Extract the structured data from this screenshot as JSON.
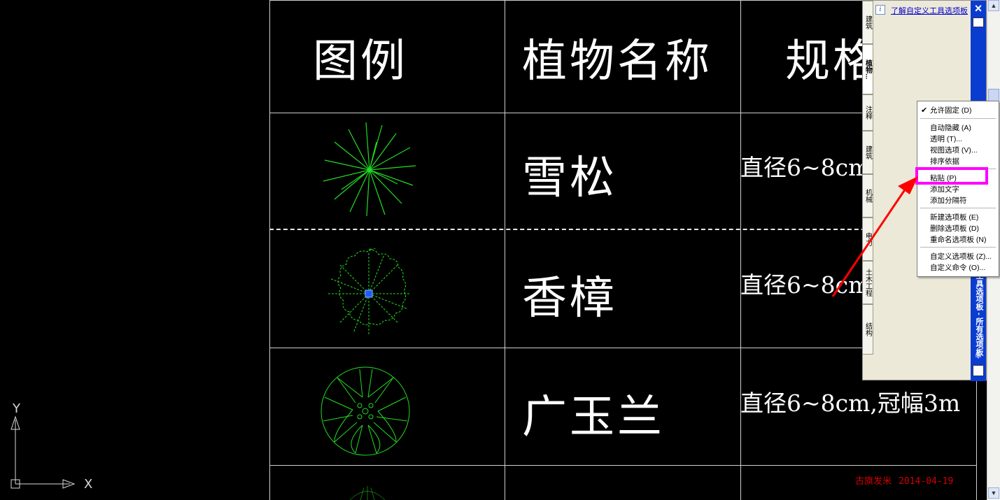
{
  "table": {
    "headers": {
      "legend": "图例",
      "plant_name": "植物名称",
      "spec": "规格"
    },
    "rows": [
      {
        "name": "雪松",
        "spec": "直径6~8cm"
      },
      {
        "name": "香樟",
        "spec": "直径6~8cm"
      },
      {
        "name": "广玉兰",
        "spec": "直径6~8cm,冠幅3m"
      }
    ]
  },
  "ucs": {
    "x_label": "X",
    "y_label": "Y"
  },
  "stamp": {
    "author": "古旗发米",
    "date": "2014-04-19"
  },
  "palette": {
    "help_link": "了解自定义工具选项板",
    "title": "工具选项板 - 所有选项板",
    "tabs": [
      "建筑",
      "植物...",
      "注释",
      "建筑",
      "机械",
      "电力",
      "土木工程",
      "结构"
    ]
  },
  "context_menu": {
    "items": [
      "允许固定 (D)",
      "自动隐藏 (A)",
      "透明 (T)...",
      "视图选项 (V)...",
      "排序依据",
      "粘贴 (P)",
      "添加文字",
      "添加分隔符",
      "新建选项板 (E)",
      "删除选项板 (D)",
      "重命名选项板 (N)",
      "自定义选项板 (Z)...",
      "自定义命令 (O)..."
    ],
    "checked_item": "允许固定 (D)",
    "highlighted_item": "粘贴 (P)"
  },
  "colors": {
    "background": "#000000",
    "symbol_green": "#22dd22",
    "highlight": "#ff00ff",
    "arrow": "#ff0000",
    "palette_title": "#0a3cd0"
  }
}
